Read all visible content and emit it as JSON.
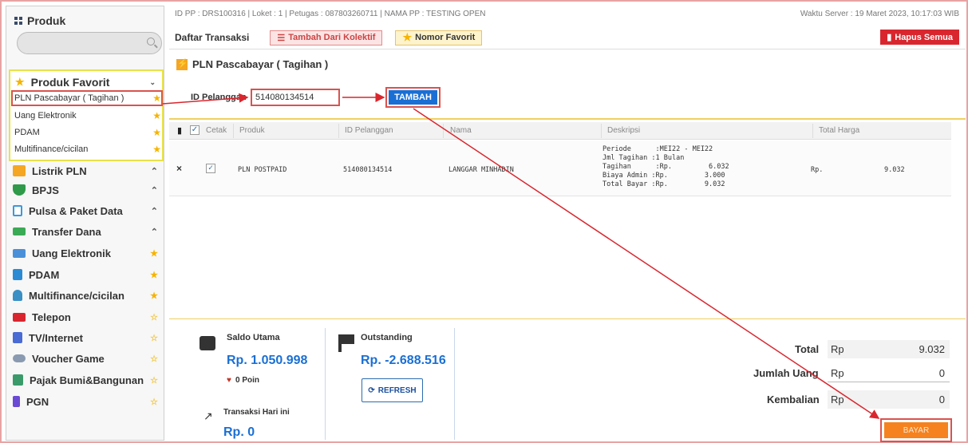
{
  "sidebar": {
    "title": "Produk",
    "search_placeholder": "",
    "favorites": {
      "header": "Produk Favorit",
      "items": [
        {
          "label": "PLN Pascabayar ( Tagihan )"
        },
        {
          "label": "Uang Elektronik"
        },
        {
          "label": "PDAM"
        },
        {
          "label": "Multifinance/cicilan"
        }
      ]
    },
    "menu": [
      {
        "label": "Listrik PLN",
        "icon": "bolt-icon",
        "color": "#f5a623",
        "right": "chevron-up"
      },
      {
        "label": "BPJS",
        "icon": "shield-icon",
        "color": "#2e9a4a",
        "right": "chevron-up"
      },
      {
        "label": "Pulsa & Paket Data",
        "icon": "phone-icon",
        "color": "#3a9ad9",
        "right": "chevron-up"
      },
      {
        "label": "Transfer Dana",
        "icon": "money-icon",
        "color": "#3aaa55",
        "right": "chevron-up"
      },
      {
        "label": "Uang Elektronik",
        "icon": "card-icon",
        "color": "#4a90d9",
        "right": "star"
      },
      {
        "label": "PDAM",
        "icon": "tap-icon",
        "color": "#2a8bd4",
        "right": "star"
      },
      {
        "label": "Multifinance/cicilan",
        "icon": "person-icon",
        "color": "#3a8fc4",
        "right": "star"
      },
      {
        "label": "Telepon",
        "icon": "telephone-icon",
        "color": "#d9262e",
        "right": "star-outline"
      },
      {
        "label": "TV/Internet",
        "icon": "antenna-icon",
        "color": "#4a6ad4",
        "right": "star-outline"
      },
      {
        "label": "Voucher Game",
        "icon": "gamepad-icon",
        "color": "#8a9ab0",
        "right": "star-outline"
      },
      {
        "label": "Pajak Bumi&Bangunan",
        "icon": "house-icon",
        "color": "#3a9a6a",
        "right": "star-outline"
      },
      {
        "label": "PGN",
        "icon": "gas-icon",
        "color": "#6a4ad4",
        "right": "star-outline"
      }
    ]
  },
  "header": {
    "info": "ID PP : DRS100316 | Loket : 1 | Petugas : 087803260711 | NAMA PP : TESTING OPEN",
    "server_time": "Waktu Server : 19 Maret 2023, 10:17:03 WIB"
  },
  "toolbar": {
    "title": "Daftar Transaksi",
    "tambah_kolektif": "Tambah Dari Kolektif",
    "nomor_favorit": "Nomor Favorit",
    "hapus_semua": "Hapus Semua"
  },
  "form": {
    "product_title": "PLN Pascabayar ( Tagihan )",
    "id_label": "ID Pelanggan",
    "id_value": "514080134514",
    "tambah_label": "TAMBAH"
  },
  "table": {
    "headers": {
      "cetak": "Cetak",
      "produk": "Produk",
      "id_pelanggan": "ID Pelanggan",
      "nama": "Nama",
      "deskripsi": "Deskripsi",
      "total_harga": "Total Harga"
    },
    "row": {
      "produk": "PLN POSTPAID",
      "id_pelanggan": "514080134514",
      "nama": "LANGGAR MINHADIN",
      "desc": [
        "Periode      :MEI22 - MEI22",
        "Jml Tagihan :1 Bulan",
        "Tagihan      :Rp.         6.032",
        "Biaya Admin :Rp.         3.000",
        "Total Bayar :Rp.         9.032"
      ],
      "rp": "Rp.",
      "total": "9.032"
    }
  },
  "bottom": {
    "saldo_label": "Saldo Utama",
    "saldo_value": "Rp. 1.050.998",
    "poin": "0 Poin",
    "outstanding_label": "Outstanding",
    "outstanding_value": "Rp. -2.688.516",
    "refresh_label": "REFRESH",
    "transaksi_label": "Transaksi Hari ini",
    "transaksi_value": "Rp. 0",
    "total_label": "Total",
    "total_rp": "Rp",
    "total_value": "9.032",
    "jumlah_label": "Jumlah Uang",
    "jumlah_rp": "Rp",
    "jumlah_value": "0",
    "kembalian_label": "Kembalian",
    "kembalian_rp": "Rp",
    "kembalian_value": "0",
    "bayar_label": "BAYAR"
  },
  "colors": {
    "accent_blue": "#1a6fd4",
    "annotation_red": "#d9262e",
    "bayar_orange": "#f5821f",
    "favorite_yellow": "#e8e24a"
  }
}
